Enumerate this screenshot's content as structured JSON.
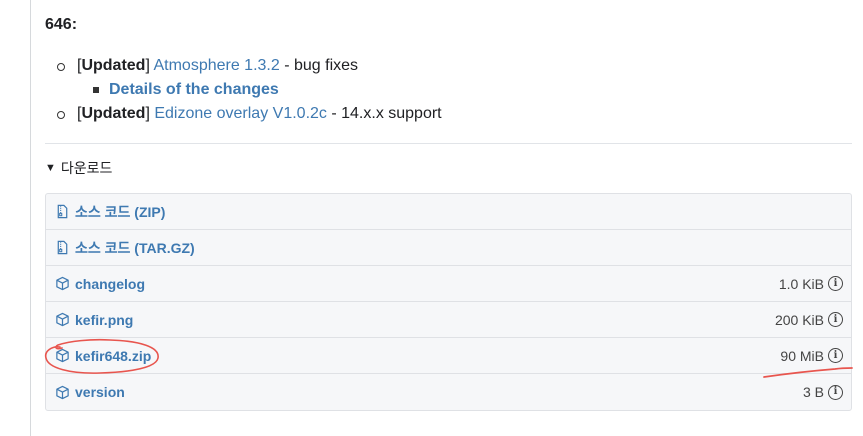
{
  "release": {
    "version_title": "646:",
    "changes": [
      {
        "tag": "Updated",
        "link_text": "Atmosphere 1.3.2",
        "suffix": " - bug fixes",
        "sub_items": [
          {
            "link_text": "Details of the changes"
          }
        ]
      },
      {
        "tag": "Updated",
        "link_text": "Edizone overlay V1.0.2c",
        "suffix": " - 14.x.x support"
      }
    ]
  },
  "downloads": {
    "summary_label": "다운로드",
    "assets": [
      {
        "name": "소스 코드 (ZIP)",
        "icon": "file-zip-icon",
        "size": ""
      },
      {
        "name": "소스 코드 (TAR.GZ)",
        "icon": "file-zip-icon",
        "size": ""
      },
      {
        "name": "changelog",
        "icon": "package-icon",
        "size": "1.0 KiB"
      },
      {
        "name": "kefir.png",
        "icon": "package-icon",
        "size": "200 KiB"
      },
      {
        "name": "kefir648.zip",
        "icon": "package-icon",
        "size": "90 MiB"
      },
      {
        "name": "version",
        "icon": "package-icon",
        "size": "3 B"
      }
    ]
  },
  "colors": {
    "link": "#3e79b1",
    "annotation": "#e8554e"
  }
}
